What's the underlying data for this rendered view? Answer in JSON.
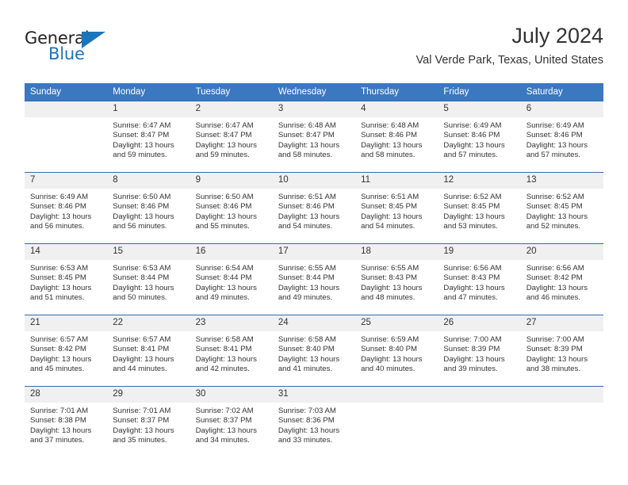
{
  "brand": {
    "name_part1": "General",
    "name_part2": "Blue",
    "triangle_icon": "triangle-icon",
    "colors": {
      "blue": "#1b75bb",
      "dark": "#231f20"
    }
  },
  "header": {
    "title": "July 2024",
    "subtitle": "Val Verde Park, Texas, United States"
  },
  "theme": {
    "header_bg": "#3a78bf",
    "daynum_bg": "#f0f0f0",
    "row_border": "#2f6cb5"
  },
  "weekday_headers": [
    "Sunday",
    "Monday",
    "Tuesday",
    "Wednesday",
    "Thursday",
    "Friday",
    "Saturday"
  ],
  "weeks": [
    [
      {
        "day": "",
        "empty": true,
        "sunrise": "",
        "sunset": "",
        "daylight_line1": "",
        "daylight_line2": ""
      },
      {
        "day": "1",
        "sunrise": "Sunrise: 6:47 AM",
        "sunset": "Sunset: 8:47 PM",
        "daylight_line1": "Daylight: 13 hours",
        "daylight_line2": "and 59 minutes."
      },
      {
        "day": "2",
        "sunrise": "Sunrise: 6:47 AM",
        "sunset": "Sunset: 8:47 PM",
        "daylight_line1": "Daylight: 13 hours",
        "daylight_line2": "and 59 minutes."
      },
      {
        "day": "3",
        "sunrise": "Sunrise: 6:48 AM",
        "sunset": "Sunset: 8:47 PM",
        "daylight_line1": "Daylight: 13 hours",
        "daylight_line2": "and 58 minutes."
      },
      {
        "day": "4",
        "sunrise": "Sunrise: 6:48 AM",
        "sunset": "Sunset: 8:46 PM",
        "daylight_line1": "Daylight: 13 hours",
        "daylight_line2": "and 58 minutes."
      },
      {
        "day": "5",
        "sunrise": "Sunrise: 6:49 AM",
        "sunset": "Sunset: 8:46 PM",
        "daylight_line1": "Daylight: 13 hours",
        "daylight_line2": "and 57 minutes."
      },
      {
        "day": "6",
        "sunrise": "Sunrise: 6:49 AM",
        "sunset": "Sunset: 8:46 PM",
        "daylight_line1": "Daylight: 13 hours",
        "daylight_line2": "and 57 minutes."
      }
    ],
    [
      {
        "day": "7",
        "sunrise": "Sunrise: 6:49 AM",
        "sunset": "Sunset: 8:46 PM",
        "daylight_line1": "Daylight: 13 hours",
        "daylight_line2": "and 56 minutes."
      },
      {
        "day": "8",
        "sunrise": "Sunrise: 6:50 AM",
        "sunset": "Sunset: 8:46 PM",
        "daylight_line1": "Daylight: 13 hours",
        "daylight_line2": "and 56 minutes."
      },
      {
        "day": "9",
        "sunrise": "Sunrise: 6:50 AM",
        "sunset": "Sunset: 8:46 PM",
        "daylight_line1": "Daylight: 13 hours",
        "daylight_line2": "and 55 minutes."
      },
      {
        "day": "10",
        "sunrise": "Sunrise: 6:51 AM",
        "sunset": "Sunset: 8:46 PM",
        "daylight_line1": "Daylight: 13 hours",
        "daylight_line2": "and 54 minutes."
      },
      {
        "day": "11",
        "sunrise": "Sunrise: 6:51 AM",
        "sunset": "Sunset: 8:45 PM",
        "daylight_line1": "Daylight: 13 hours",
        "daylight_line2": "and 54 minutes."
      },
      {
        "day": "12",
        "sunrise": "Sunrise: 6:52 AM",
        "sunset": "Sunset: 8:45 PM",
        "daylight_line1": "Daylight: 13 hours",
        "daylight_line2": "and 53 minutes."
      },
      {
        "day": "13",
        "sunrise": "Sunrise: 6:52 AM",
        "sunset": "Sunset: 8:45 PM",
        "daylight_line1": "Daylight: 13 hours",
        "daylight_line2": "and 52 minutes."
      }
    ],
    [
      {
        "day": "14",
        "sunrise": "Sunrise: 6:53 AM",
        "sunset": "Sunset: 8:45 PM",
        "daylight_line1": "Daylight: 13 hours",
        "daylight_line2": "and 51 minutes."
      },
      {
        "day": "15",
        "sunrise": "Sunrise: 6:53 AM",
        "sunset": "Sunset: 8:44 PM",
        "daylight_line1": "Daylight: 13 hours",
        "daylight_line2": "and 50 minutes."
      },
      {
        "day": "16",
        "sunrise": "Sunrise: 6:54 AM",
        "sunset": "Sunset: 8:44 PM",
        "daylight_line1": "Daylight: 13 hours",
        "daylight_line2": "and 49 minutes."
      },
      {
        "day": "17",
        "sunrise": "Sunrise: 6:55 AM",
        "sunset": "Sunset: 8:44 PM",
        "daylight_line1": "Daylight: 13 hours",
        "daylight_line2": "and 49 minutes."
      },
      {
        "day": "18",
        "sunrise": "Sunrise: 6:55 AM",
        "sunset": "Sunset: 8:43 PM",
        "daylight_line1": "Daylight: 13 hours",
        "daylight_line2": "and 48 minutes."
      },
      {
        "day": "19",
        "sunrise": "Sunrise: 6:56 AM",
        "sunset": "Sunset: 8:43 PM",
        "daylight_line1": "Daylight: 13 hours",
        "daylight_line2": "and 47 minutes."
      },
      {
        "day": "20",
        "sunrise": "Sunrise: 6:56 AM",
        "sunset": "Sunset: 8:42 PM",
        "daylight_line1": "Daylight: 13 hours",
        "daylight_line2": "and 46 minutes."
      }
    ],
    [
      {
        "day": "21",
        "sunrise": "Sunrise: 6:57 AM",
        "sunset": "Sunset: 8:42 PM",
        "daylight_line1": "Daylight: 13 hours",
        "daylight_line2": "and 45 minutes."
      },
      {
        "day": "22",
        "sunrise": "Sunrise: 6:57 AM",
        "sunset": "Sunset: 8:41 PM",
        "daylight_line1": "Daylight: 13 hours",
        "daylight_line2": "and 44 minutes."
      },
      {
        "day": "23",
        "sunrise": "Sunrise: 6:58 AM",
        "sunset": "Sunset: 8:41 PM",
        "daylight_line1": "Daylight: 13 hours",
        "daylight_line2": "and 42 minutes."
      },
      {
        "day": "24",
        "sunrise": "Sunrise: 6:58 AM",
        "sunset": "Sunset: 8:40 PM",
        "daylight_line1": "Daylight: 13 hours",
        "daylight_line2": "and 41 minutes."
      },
      {
        "day": "25",
        "sunrise": "Sunrise: 6:59 AM",
        "sunset": "Sunset: 8:40 PM",
        "daylight_line1": "Daylight: 13 hours",
        "daylight_line2": "and 40 minutes."
      },
      {
        "day": "26",
        "sunrise": "Sunrise: 7:00 AM",
        "sunset": "Sunset: 8:39 PM",
        "daylight_line1": "Daylight: 13 hours",
        "daylight_line2": "and 39 minutes."
      },
      {
        "day": "27",
        "sunrise": "Sunrise: 7:00 AM",
        "sunset": "Sunset: 8:39 PM",
        "daylight_line1": "Daylight: 13 hours",
        "daylight_line2": "and 38 minutes."
      }
    ],
    [
      {
        "day": "28",
        "sunrise": "Sunrise: 7:01 AM",
        "sunset": "Sunset: 8:38 PM",
        "daylight_line1": "Daylight: 13 hours",
        "daylight_line2": "and 37 minutes."
      },
      {
        "day": "29",
        "sunrise": "Sunrise: 7:01 AM",
        "sunset": "Sunset: 8:37 PM",
        "daylight_line1": "Daylight: 13 hours",
        "daylight_line2": "and 35 minutes."
      },
      {
        "day": "30",
        "sunrise": "Sunrise: 7:02 AM",
        "sunset": "Sunset: 8:37 PM",
        "daylight_line1": "Daylight: 13 hours",
        "daylight_line2": "and 34 minutes."
      },
      {
        "day": "31",
        "sunrise": "Sunrise: 7:03 AM",
        "sunset": "Sunset: 8:36 PM",
        "daylight_line1": "Daylight: 13 hours",
        "daylight_line2": "and 33 minutes."
      },
      {
        "day": "",
        "empty": true,
        "sunrise": "",
        "sunset": "",
        "daylight_line1": "",
        "daylight_line2": ""
      },
      {
        "day": "",
        "empty": true,
        "sunrise": "",
        "sunset": "",
        "daylight_line1": "",
        "daylight_line2": ""
      },
      {
        "day": "",
        "empty": true,
        "sunrise": "",
        "sunset": "",
        "daylight_line1": "",
        "daylight_line2": ""
      }
    ]
  ]
}
